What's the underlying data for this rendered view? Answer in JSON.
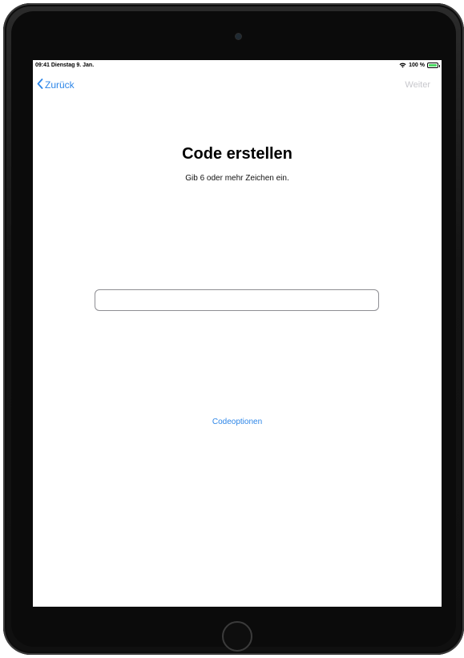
{
  "status_bar": {
    "time_date": "09:41  Dienstag 9. Jan.",
    "battery": "100 %",
    "wifi_icon": "wifi-icon",
    "battery_icon": "battery-icon"
  },
  "nav": {
    "back_label": "Zurück",
    "back_icon": "chevron-left-icon",
    "next_label": "Weiter"
  },
  "main": {
    "title": "Code erstellen",
    "subtitle": "Gib 6 oder mehr Zeichen ein.",
    "code_value": "",
    "options_label": "Codeoptionen"
  },
  "colors": {
    "accent": "#2d86e8",
    "disabled": "#c7c7cc",
    "battery_fill": "#4cd964"
  }
}
